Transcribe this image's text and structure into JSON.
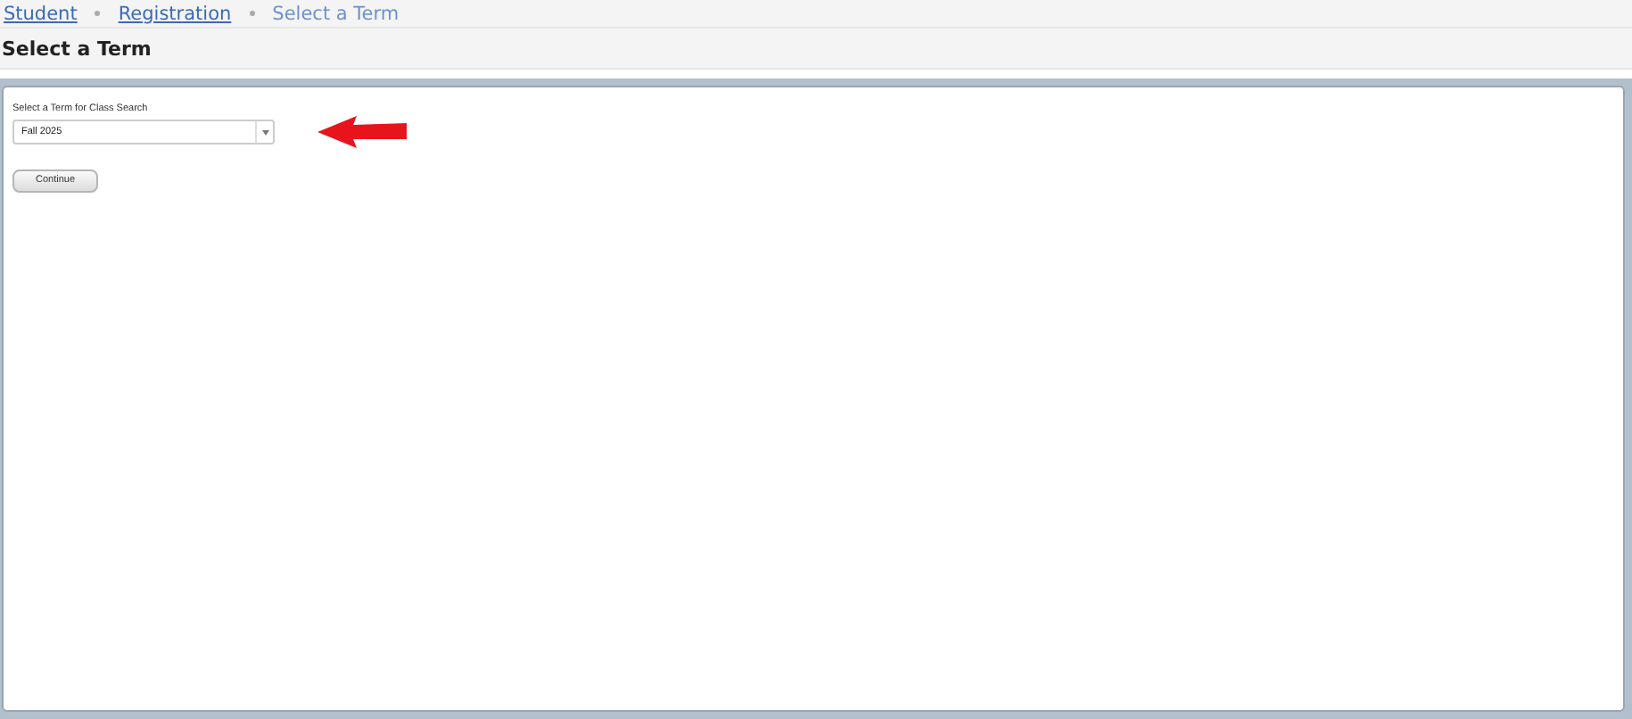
{
  "breadcrumb": [
    {
      "label": "Student",
      "kind": "link"
    },
    {
      "label": "Registration",
      "kind": "link"
    },
    {
      "label": "Select a Term",
      "kind": "current"
    }
  ],
  "page_title": "Select a Term",
  "term_field": {
    "label": "Select a Term for Class Search",
    "value": "Fall 2025"
  },
  "buttons": [
    "Continue"
  ]
}
